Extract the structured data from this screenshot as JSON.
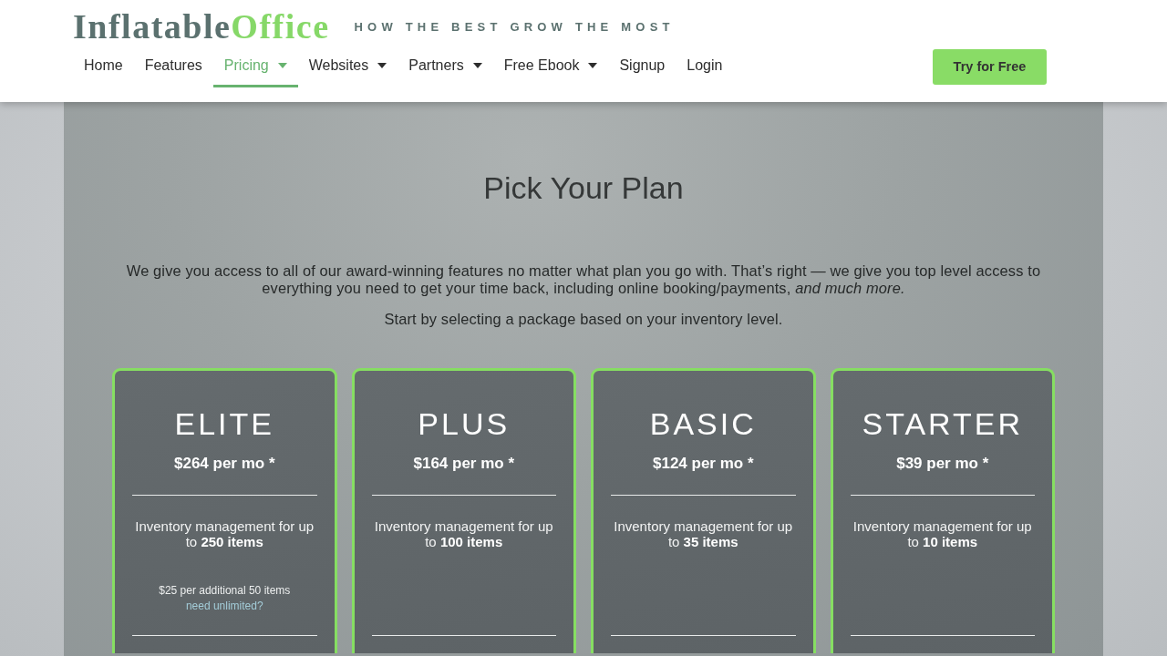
{
  "header": {
    "logo": {
      "part_1": "Inflatable",
      "part_2": "Office"
    },
    "tagline": "HOW THE BEST GROW THE MOST",
    "nav": [
      {
        "label": "Home",
        "selected": false,
        "dropdown": false
      },
      {
        "label": "Features",
        "selected": false,
        "dropdown": false
      },
      {
        "label": "Pricing",
        "selected": true,
        "dropdown": true
      },
      {
        "label": "Websites",
        "selected": false,
        "dropdown": true
      },
      {
        "label": "Partners",
        "selected": false,
        "dropdown": true
      },
      {
        "label": "Free Ebook",
        "selected": false,
        "dropdown": true
      },
      {
        "label": "Signup",
        "selected": false,
        "dropdown": false
      },
      {
        "label": "Login",
        "selected": false,
        "dropdown": false
      }
    ],
    "cta_button": "Try for Free"
  },
  "main": {
    "title": "Pick Your Plan",
    "intro": "We give you access to all of our award-winning features no matter what plan you go with. That’s right — we give you top level access to everything you need to get your time back, including online booking/payments, *and much more.*",
    "note": "Start by selecting a package based on your inventory level.",
    "plans": [
      {
        "name": "ELITE",
        "price": "$264 per mo *",
        "description": "Inventory management for up to **250 items**",
        "extra": "$25 per additional 50 items",
        "link": "need unlimited?"
      },
      {
        "name": "PLUS",
        "price": "$164 per mo *",
        "description": "Inventory management for up to **100 items**"
      },
      {
        "name": "BASIC",
        "price": "$124 per mo *",
        "description": "Inventory management for up to **35 items**"
      },
      {
        "name": "STARTER",
        "price": "$39 per mo *",
        "description": "Inventory management for up to **10 items**"
      }
    ]
  }
}
